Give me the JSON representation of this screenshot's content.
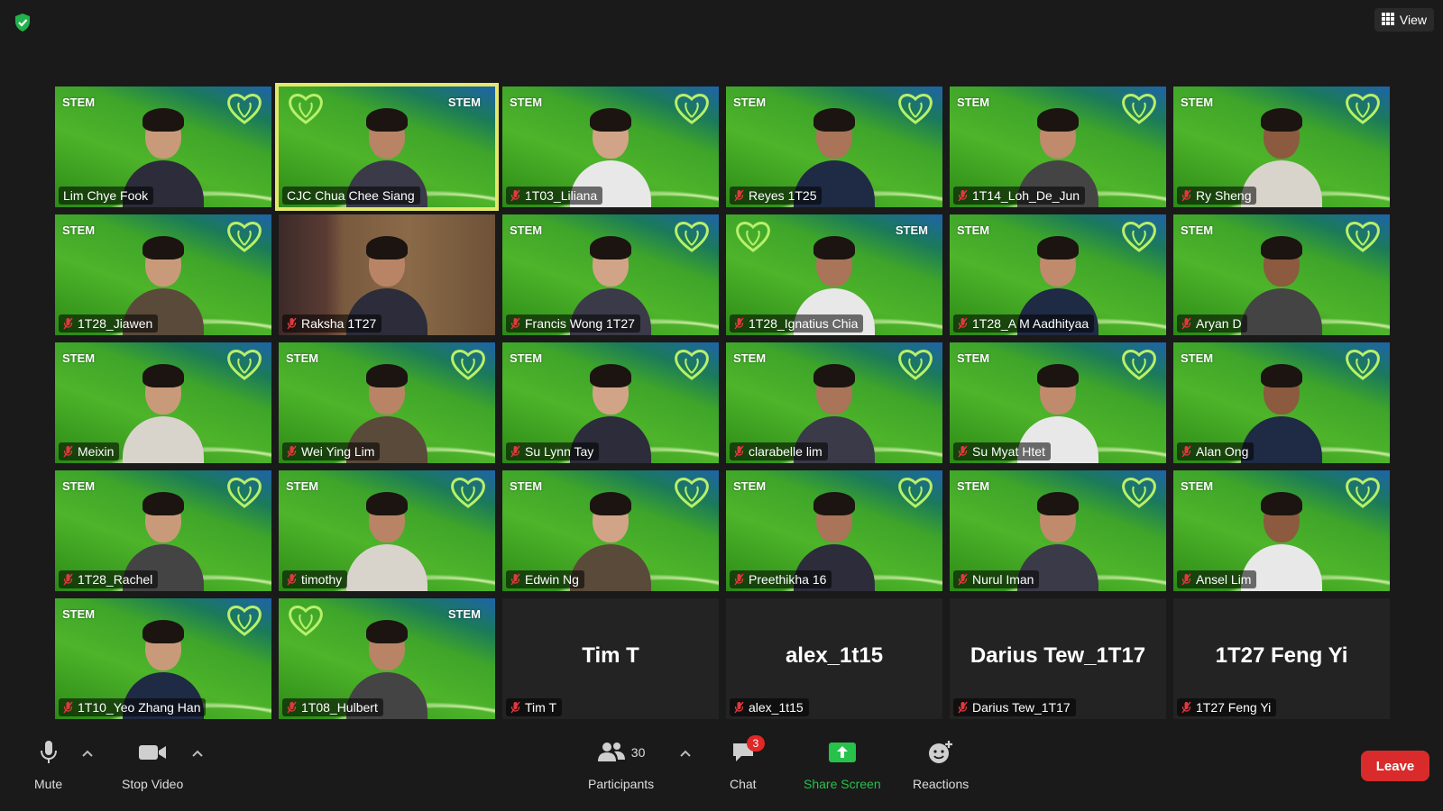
{
  "top": {
    "view_label": "View"
  },
  "participants": [
    {
      "name": "Lim Chye Fook",
      "background": "green",
      "muted": false
    },
    {
      "name": "CJC Chua Chee Siang",
      "background": "green-mirror",
      "muted": false,
      "active": true
    },
    {
      "name": "1T03_Liliana",
      "background": "green",
      "muted": true
    },
    {
      "name": "Reyes 1T25",
      "background": "green",
      "muted": true
    },
    {
      "name": "1T14_Loh_De_Jun",
      "background": "green",
      "muted": true
    },
    {
      "name": "Ry Sheng",
      "background": "green",
      "muted": true
    },
    {
      "name": "1T28_Jiawen",
      "background": "green",
      "muted": true
    },
    {
      "name": "Raksha 1T27",
      "background": "room",
      "muted": true
    },
    {
      "name": "Francis Wong 1T27",
      "background": "green",
      "muted": true
    },
    {
      "name": "1T28_Ignatius Chia",
      "background": "green-mirror",
      "muted": true
    },
    {
      "name": "1T28_A M Aadhityaa",
      "background": "green",
      "muted": true
    },
    {
      "name": "Aryan D",
      "background": "green",
      "muted": true
    },
    {
      "name": "Meixin",
      "background": "green",
      "muted": true
    },
    {
      "name": "Wei Ying Lim",
      "background": "green",
      "muted": true
    },
    {
      "name": "Su Lynn Tay",
      "background": "green",
      "muted": true
    },
    {
      "name": "clarabelle lim",
      "background": "green",
      "muted": true
    },
    {
      "name": "Su Myat Htet",
      "background": "green",
      "muted": true
    },
    {
      "name": "Alan Ong",
      "background": "green",
      "muted": true
    },
    {
      "name": "1T28_Rachel",
      "background": "green",
      "muted": true
    },
    {
      "name": "timothy",
      "background": "green",
      "muted": true
    },
    {
      "name": "Edwin Ng",
      "background": "green",
      "muted": true
    },
    {
      "name": "Preethikha 16",
      "background": "green",
      "muted": true
    },
    {
      "name": "Nurul Iman",
      "background": "green",
      "muted": true
    },
    {
      "name": "Ansel Lim",
      "background": "green",
      "muted": true
    },
    {
      "name": "1T10_Yeo Zhang Han",
      "background": "green",
      "muted": true
    },
    {
      "name": "1T08_Hulbert",
      "background": "green-mirror",
      "muted": true
    },
    {
      "name": "Tim T",
      "background": "none",
      "muted": true,
      "video_off": true
    },
    {
      "name": "alex_1t15",
      "background": "none",
      "muted": true,
      "video_off": true
    },
    {
      "name": "Darius Tew_1T17",
      "background": "none",
      "muted": true,
      "video_off": true
    },
    {
      "name": "1T27 Feng Yi",
      "background": "none",
      "muted": true,
      "video_off": true
    }
  ],
  "logo_text": "STEM",
  "toolbar": {
    "mute_label": "Mute",
    "stop_video_label": "Stop Video",
    "participants_label": "Participants",
    "participants_count": "30",
    "chat_label": "Chat",
    "chat_badge": "3",
    "share_label": "Share Screen",
    "reactions_label": "Reactions",
    "leave_label": "Leave"
  },
  "colors": {
    "active_speaker_outline": "#e4e86a",
    "share_green": "#26c24a",
    "leave_red": "#d92b2b",
    "muted_red": "#e0393e"
  },
  "icons": {
    "shield": "security-shield-icon",
    "grid": "grid-view-icon",
    "mic": "microphone-icon",
    "camera": "video-camera-icon",
    "people": "participants-icon",
    "chat": "chat-bubble-icon",
    "share": "share-screen-arrow-icon",
    "reactions": "emoji-reactions-icon"
  }
}
